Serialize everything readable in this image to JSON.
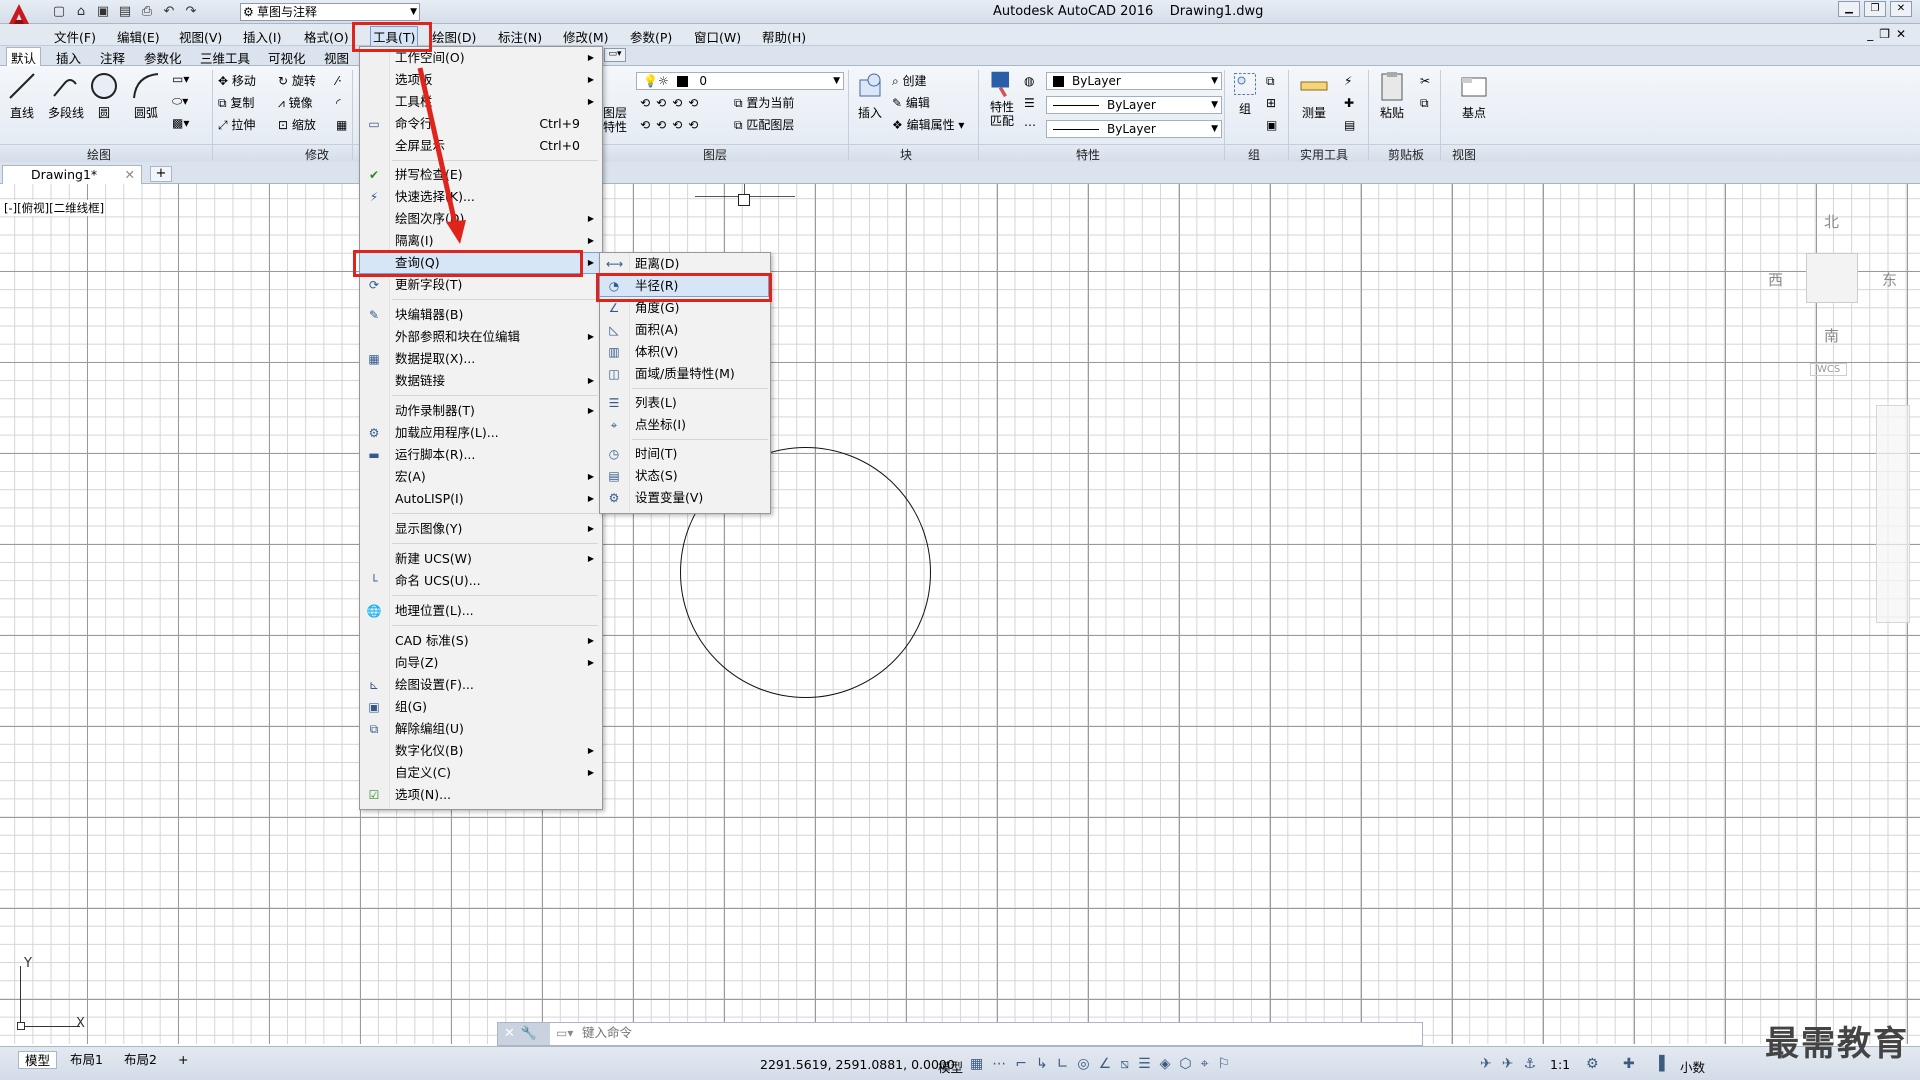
{
  "app": {
    "title": "Autodesk AutoCAD 2016    Drawing1.dwg",
    "workspace": "草图与注释"
  },
  "menubar": {
    "items": [
      "文件(F)",
      "编辑(E)",
      "视图(V)",
      "插入(I)",
      "格式(O)",
      "工具(T)",
      "绘图(D)",
      "标注(N)",
      "修改(M)",
      "参数(P)",
      "窗口(W)",
      "帮助(H)"
    ]
  },
  "ribbon": {
    "tabs": [
      "默认",
      "插入",
      "注释",
      "参数化",
      "三维工具",
      "可视化",
      "视图"
    ],
    "draw": {
      "title": "绘图",
      "line": "直线",
      "polyline": "多段线",
      "circle": "圆",
      "arc": "圆弧"
    },
    "modify": {
      "title": "修改",
      "move": "移动",
      "rotate": "旋转",
      "copy": "复制",
      "mirror": "镜像",
      "stretch": "拉伸",
      "scale": "缩放"
    },
    "layers": {
      "title": "图层",
      "layer_props_1": "图层",
      "layer_props_2": "特性",
      "current_layer": "0",
      "make_current": "置为当前",
      "match_layer": "匹配图层"
    },
    "block": {
      "title": "块",
      "insert": "插入",
      "create": "创建",
      "edit": "编辑",
      "edit_attr": "编辑属性"
    },
    "properties": {
      "title": "特性",
      "match_1": "特性",
      "match_2": "匹配",
      "color": "ByLayer",
      "linetype": "ByLayer",
      "lineweight": "ByLayer"
    },
    "groups": {
      "title": "组",
      "group": "组"
    },
    "utilities": {
      "title": "实用工具",
      "measure": "测量"
    },
    "clipboard": {
      "title": "剪贴板",
      "paste": "粘贴"
    },
    "view": {
      "title": "视图",
      "base": "基点"
    }
  },
  "filetab": {
    "name": "Drawing1*"
  },
  "viewport_label": "[-][俯视][二维线框]",
  "viewcube": {
    "north": "北",
    "south": "南",
    "east": "东",
    "west": "西",
    "wcs": "WCS"
  },
  "ucs": {
    "x": "X",
    "y": "Y"
  },
  "tools_menu": {
    "items": [
      {
        "label": "工作空间(O)",
        "shortcut": "",
        "sub": true
      },
      {
        "label": "选项板",
        "shortcut": "",
        "sub": true
      },
      {
        "label": "工具栏",
        "shortcut": "",
        "sub": true
      },
      {
        "label": "命令行",
        "shortcut": "Ctrl+9",
        "sub": false
      },
      {
        "label": "全屏显示",
        "shortcut": "Ctrl+0",
        "sub": false
      },
      {
        "label": "拼写检查(E)",
        "shortcut": "",
        "sub": false
      },
      {
        "label": "快速选择(K)...",
        "shortcut": "",
        "sub": false
      },
      {
        "label": "绘图次序(D)",
        "shortcut": "",
        "sub": true
      },
      {
        "label": "隔离(I)",
        "shortcut": "",
        "sub": true
      },
      {
        "label": "查询(Q)",
        "shortcut": "",
        "sub": true
      },
      {
        "label": "更新字段(T)",
        "shortcut": "",
        "sub": false
      },
      {
        "label": "块编辑器(B)",
        "shortcut": "",
        "sub": false
      },
      {
        "label": "外部参照和块在位编辑",
        "shortcut": "",
        "sub": true
      },
      {
        "label": "数据提取(X)...",
        "shortcut": "",
        "sub": false
      },
      {
        "label": "数据链接",
        "shortcut": "",
        "sub": true
      },
      {
        "label": "动作录制器(T)",
        "shortcut": "",
        "sub": true
      },
      {
        "label": "加载应用程序(L)...",
        "shortcut": "",
        "sub": false
      },
      {
        "label": "运行脚本(R)...",
        "shortcut": "",
        "sub": false
      },
      {
        "label": "宏(A)",
        "shortcut": "",
        "sub": true
      },
      {
        "label": "AutoLISP(I)",
        "shortcut": "",
        "sub": true
      },
      {
        "label": "显示图像(Y)",
        "shortcut": "",
        "sub": true
      },
      {
        "label": "新建 UCS(W)",
        "shortcut": "",
        "sub": true
      },
      {
        "label": "命名 UCS(U)...",
        "shortcut": "",
        "sub": false
      },
      {
        "label": "地理位置(L)...",
        "shortcut": "",
        "sub": false
      },
      {
        "label": "CAD 标准(S)",
        "shortcut": "",
        "sub": true
      },
      {
        "label": "向导(Z)",
        "shortcut": "",
        "sub": true
      },
      {
        "label": "绘图设置(F)...",
        "shortcut": "",
        "sub": false
      },
      {
        "label": "组(G)",
        "shortcut": "",
        "sub": false
      },
      {
        "label": "解除编组(U)",
        "shortcut": "",
        "sub": false
      },
      {
        "label": "数字化仪(B)",
        "shortcut": "",
        "sub": true
      },
      {
        "label": "自定义(C)",
        "shortcut": "",
        "sub": true
      },
      {
        "label": "选项(N)...",
        "shortcut": "",
        "sub": false
      }
    ]
  },
  "query_menu": {
    "items": [
      {
        "label": "距离(D)"
      },
      {
        "label": "半径(R)"
      },
      {
        "label": "角度(G)"
      },
      {
        "label": "面积(A)"
      },
      {
        "label": "体积(V)"
      },
      {
        "label": "面域/质量特性(M)"
      },
      {
        "label": "列表(L)"
      },
      {
        "label": "点坐标(I)"
      },
      {
        "label": "时间(T)"
      },
      {
        "label": "状态(S)"
      },
      {
        "label": "设置变量(V)"
      }
    ]
  },
  "command": {
    "placeholder": "键入命令"
  },
  "statusbar": {
    "layout_tabs": [
      "模型",
      "布局1",
      "布局2"
    ],
    "coords": "2291.5619, 2591.0881, 0.0000",
    "model": "模型",
    "scale": "1:1",
    "units": "小数"
  },
  "watermark": "最需教育"
}
